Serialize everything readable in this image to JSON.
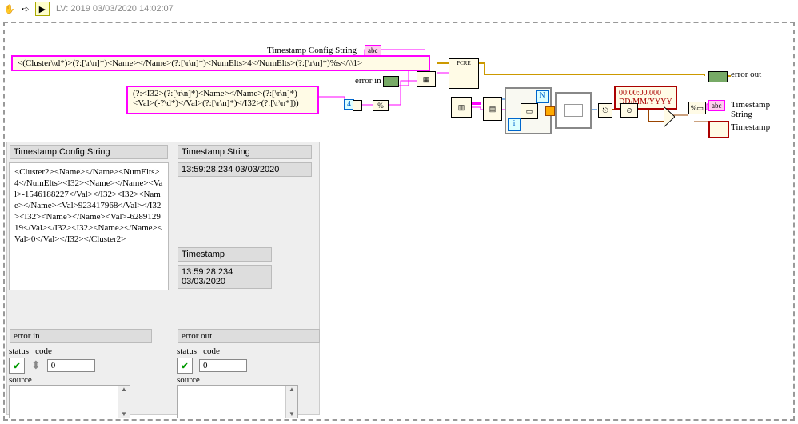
{
  "toolbar": {
    "title": "LV: 2019 03/03/2020 14:02:07"
  },
  "bd": {
    "config_label": "Timestamp Config String",
    "regex1": "<(Cluster\\\\d*)>(?:[\\r\\n]*)<Name></Name>(?:[\\r\\n]*)<NumElts>4</NumElts>(?:[\\r\\n]*)%s</\\\\1>",
    "regex2": "(?:<I32>(?:[\\r\\n]*)<Name></Name>(?:[\\r\\n]*)<Val>(-?\\d*)</Val>(?:[\\r\\n]*)</I32>(?:[\\r\\n*]))",
    "four": "4",
    "errin": "error in",
    "errout": "error out",
    "ts_string_lbl": "Timestamp String",
    "ts_lbl": "Timestamp",
    "fmt": "00:00:00.000\nDD/MM/YYYY",
    "N": "N",
    "i": "i",
    "abc": "abc",
    "pcre": "PCRE"
  },
  "fp": {
    "cfg_title": "Timestamp Config String",
    "cfg_body": "<Cluster2><Name></Name><NumElts>4</NumElts><I32><Name></Name><Val>-1546188227</Val></I32><I32><Name></Name><Val>923417968</Val></I32><I32><Name></Name><Val>-628912919</Val></I32><I32><Name></Name><Val>0</Val></I32></Cluster2>",
    "tsstr_title": "Timestamp String",
    "tsstr_val": "13:59:28.234 03/03/2020",
    "ts_title": "Timestamp",
    "ts_val": "13:59:28.234\n03/03/2020",
    "errin_title": "error in",
    "errout_title": "error out",
    "status": "status",
    "code": "code",
    "code_val": "0",
    "source": "source",
    "check": "✔"
  }
}
